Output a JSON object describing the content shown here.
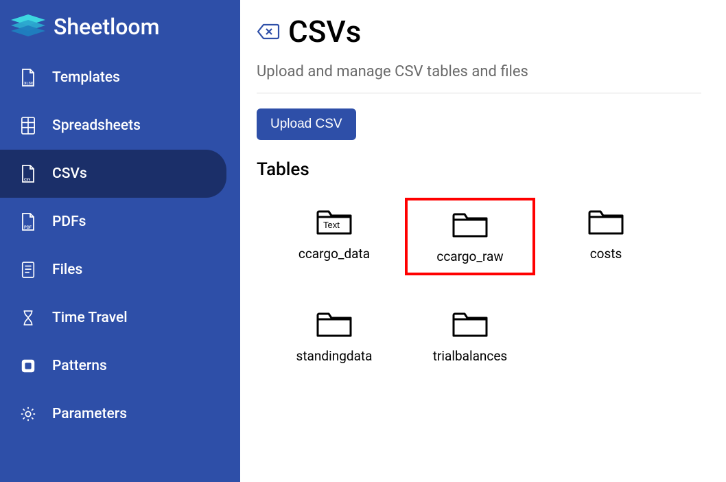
{
  "brand": {
    "name": "Sheetloom"
  },
  "sidebar": {
    "items": [
      {
        "label": "Templates"
      },
      {
        "label": "Spreadsheets"
      },
      {
        "label": "CSVs"
      },
      {
        "label": "PDFs"
      },
      {
        "label": "Files"
      },
      {
        "label": "Time Travel"
      },
      {
        "label": "Patterns"
      },
      {
        "label": "Parameters"
      }
    ]
  },
  "page": {
    "title": "CSVs",
    "subtitle": "Upload and manage CSV tables and files",
    "upload_btn": "Upload CSV",
    "section_title": "Tables"
  },
  "tables": [
    {
      "name": "ccargo_data",
      "variant": "text"
    },
    {
      "name": "ccargo_raw",
      "highlighted": true
    },
    {
      "name": "costs"
    },
    {
      "name": "standingdata"
    },
    {
      "name": "trialbalances"
    }
  ]
}
